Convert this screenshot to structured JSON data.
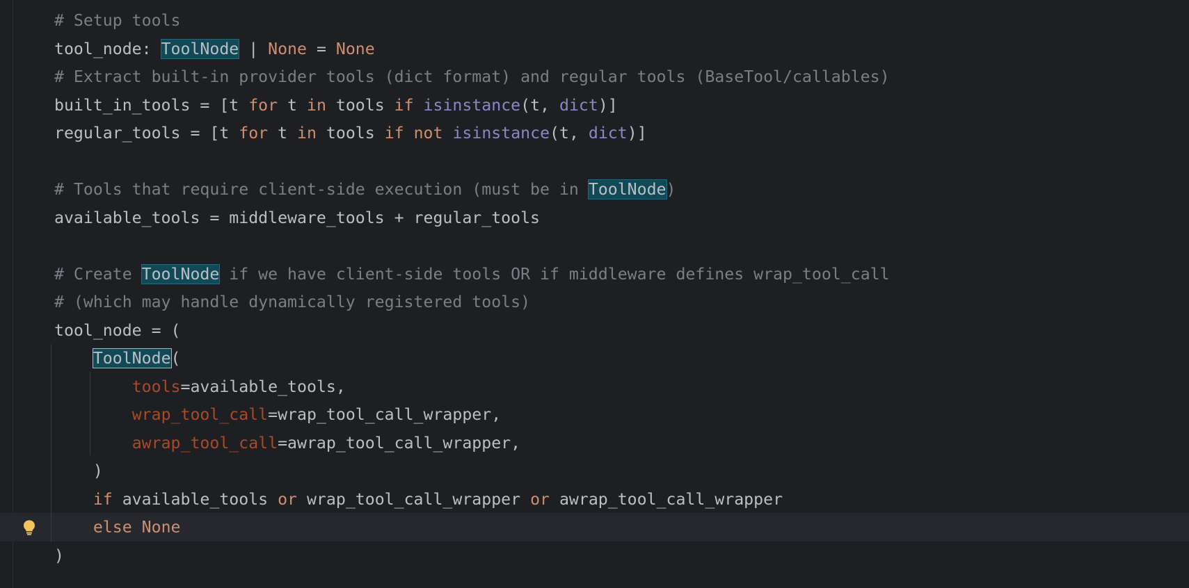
{
  "code_lines": [
    {
      "tokens": [
        {
          "text": "# Setup tools",
          "cls": "comment"
        }
      ]
    },
    {
      "tokens": [
        {
          "text": "tool_node: ",
          "cls": "plain"
        },
        {
          "text": "ToolNode",
          "cls": "hl"
        },
        {
          "text": " | ",
          "cls": "plain"
        },
        {
          "text": "None",
          "cls": "kw"
        },
        {
          "text": " = ",
          "cls": "plain"
        },
        {
          "text": "None",
          "cls": "kw"
        }
      ]
    },
    {
      "tokens": [
        {
          "text": "# Extract built-in provider tools (dict format) and regular tools (BaseTool/callables)",
          "cls": "comment"
        }
      ]
    },
    {
      "tokens": [
        {
          "text": "built_in_tools = [t ",
          "cls": "plain"
        },
        {
          "text": "for",
          "cls": "kw"
        },
        {
          "text": " t ",
          "cls": "plain"
        },
        {
          "text": "in",
          "cls": "kw"
        },
        {
          "text": " tools ",
          "cls": "plain"
        },
        {
          "text": "if",
          "cls": "kw"
        },
        {
          "text": " ",
          "cls": "plain"
        },
        {
          "text": "isinstance",
          "cls": "builtin"
        },
        {
          "text": "(t, ",
          "cls": "plain"
        },
        {
          "text": "dict",
          "cls": "builtin"
        },
        {
          "text": ")]",
          "cls": "plain"
        }
      ]
    },
    {
      "tokens": [
        {
          "text": "regular_tools = [t ",
          "cls": "plain"
        },
        {
          "text": "for",
          "cls": "kw"
        },
        {
          "text": " t ",
          "cls": "plain"
        },
        {
          "text": "in",
          "cls": "kw"
        },
        {
          "text": " tools ",
          "cls": "plain"
        },
        {
          "text": "if",
          "cls": "kw"
        },
        {
          "text": " ",
          "cls": "plain"
        },
        {
          "text": "not",
          "cls": "kw"
        },
        {
          "text": " ",
          "cls": "plain"
        },
        {
          "text": "isinstance",
          "cls": "builtin"
        },
        {
          "text": "(t, ",
          "cls": "plain"
        },
        {
          "text": "dict",
          "cls": "builtin"
        },
        {
          "text": ")]",
          "cls": "plain"
        }
      ]
    },
    {
      "tokens": []
    },
    {
      "tokens": [
        {
          "text": "# Tools that require client-side execution (must be in ",
          "cls": "comment"
        },
        {
          "text": "ToolNode",
          "cls": "hl"
        },
        {
          "text": ")",
          "cls": "comment"
        }
      ]
    },
    {
      "tokens": [
        {
          "text": "available_tools = middleware_tools + regular_tools",
          "cls": "plain"
        }
      ]
    },
    {
      "tokens": []
    },
    {
      "tokens": [
        {
          "text": "# Create ",
          "cls": "comment"
        },
        {
          "text": "ToolNode",
          "cls": "hl"
        },
        {
          "text": " if we have client-side tools OR if middleware defines wrap_tool_call",
          "cls": "comment"
        }
      ]
    },
    {
      "tokens": [
        {
          "text": "# (which may handle dynamically registered tools)",
          "cls": "comment"
        }
      ]
    },
    {
      "tokens": [
        {
          "text": "tool_node = (",
          "cls": "plain"
        }
      ]
    },
    {
      "tokens": [
        {
          "text": "    ",
          "cls": "plain"
        },
        {
          "text": "ToolNode",
          "cls": "hl-caret"
        },
        {
          "text": "(",
          "cls": "plain"
        }
      ]
    },
    {
      "tokens": [
        {
          "text": "        ",
          "cls": "plain"
        },
        {
          "text": "tools",
          "cls": "param"
        },
        {
          "text": "=available_tools,",
          "cls": "plain"
        }
      ]
    },
    {
      "tokens": [
        {
          "text": "        ",
          "cls": "plain"
        },
        {
          "text": "wrap_tool_call",
          "cls": "param"
        },
        {
          "text": "=wrap_tool_call_wrapper,",
          "cls": "plain"
        }
      ]
    },
    {
      "tokens": [
        {
          "text": "        ",
          "cls": "plain"
        },
        {
          "text": "awrap_tool_call",
          "cls": "param"
        },
        {
          "text": "=awrap_tool_call_wrapper,",
          "cls": "plain"
        }
      ]
    },
    {
      "tokens": [
        {
          "text": "    )",
          "cls": "plain"
        }
      ]
    },
    {
      "tokens": [
        {
          "text": "    ",
          "cls": "plain"
        },
        {
          "text": "if",
          "cls": "kw"
        },
        {
          "text": " available_tools ",
          "cls": "plain"
        },
        {
          "text": "or",
          "cls": "kw"
        },
        {
          "text": " wrap_tool_call_wrapper ",
          "cls": "plain"
        },
        {
          "text": "or",
          "cls": "kw"
        },
        {
          "text": " awrap_tool_call_wrapper",
          "cls": "plain"
        }
      ]
    },
    {
      "tokens": [
        {
          "text": "    ",
          "cls": "plain"
        },
        {
          "text": "else",
          "cls": "kw"
        },
        {
          "text": " ",
          "cls": "plain"
        },
        {
          "text": "None",
          "cls": "kw"
        }
      ]
    },
    {
      "tokens": [
        {
          "text": ")",
          "cls": "plain"
        }
      ]
    }
  ],
  "colors": {
    "background": "#1e1f22",
    "text": "#bcbec4",
    "comment": "#7a7e85",
    "keyword": "#cf8e6d",
    "builtin": "#8888c6",
    "parameter": "#aa4926",
    "highlight": "#114957",
    "current_line": "#26282e"
  },
  "gutter": {
    "intention_icon": "lightbulb-icon"
  }
}
